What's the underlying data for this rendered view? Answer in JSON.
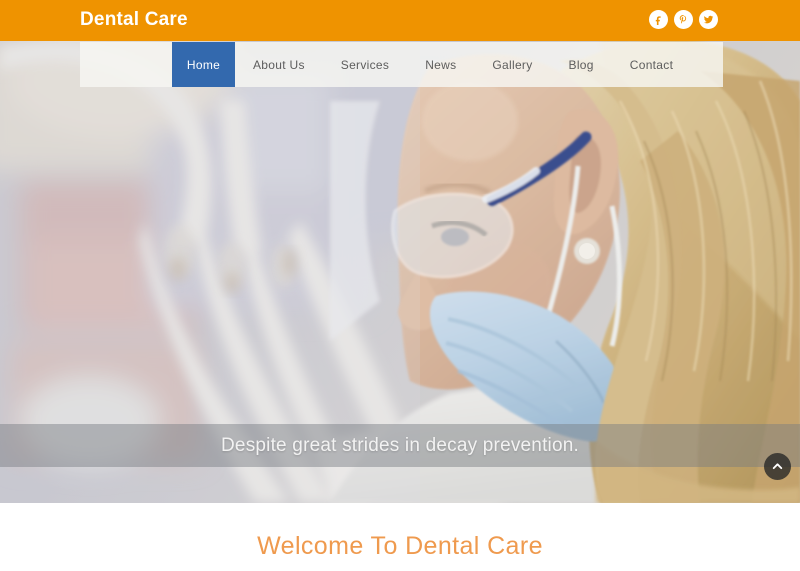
{
  "header": {
    "logo": "Dental Care",
    "brand_color": "#ef9300",
    "social": [
      {
        "name": "facebook-icon",
        "label": "Facebook"
      },
      {
        "name": "pinterest-icon",
        "label": "Pinterest"
      },
      {
        "name": "twitter-icon",
        "label": "Twitter"
      }
    ]
  },
  "nav": {
    "active": "Home",
    "active_color": "#3369ae",
    "items": [
      {
        "label": "Home",
        "active": true
      },
      {
        "label": "About Us",
        "active": false
      },
      {
        "label": "Services",
        "active": false
      },
      {
        "label": "News",
        "active": false
      },
      {
        "label": "Gallery",
        "active": false
      },
      {
        "label": "Blog",
        "active": false
      },
      {
        "label": "Contact",
        "active": false
      }
    ]
  },
  "hero": {
    "caption": "Despite great strides in decay prevention.",
    "image_alt": "Dentist in profile wearing safety glasses and a blue surgical mask",
    "scroll_top_icon": "chevron-up-icon"
  },
  "welcome": {
    "heading": "Welcome To Dental Care",
    "heading_color": "#ef9a4e"
  }
}
